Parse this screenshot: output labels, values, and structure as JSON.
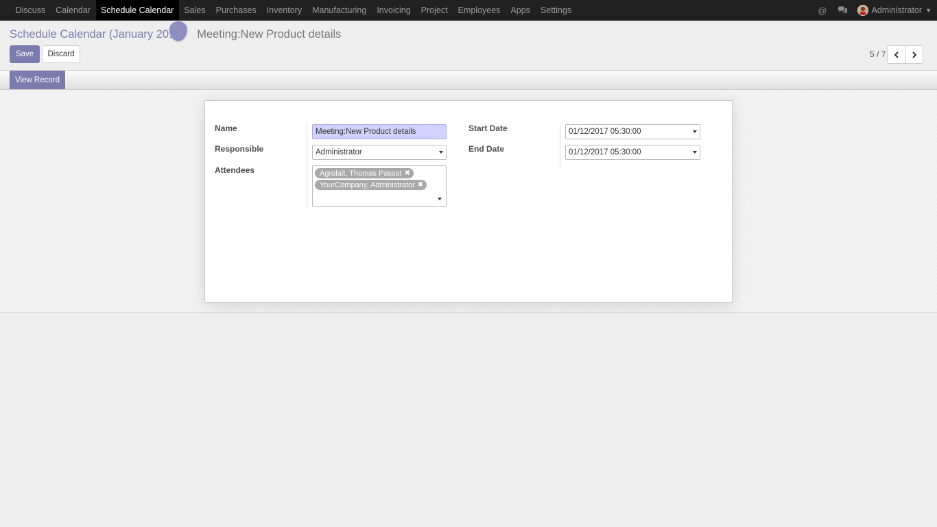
{
  "nav": {
    "items": [
      {
        "label": "Discuss"
      },
      {
        "label": "Calendar"
      },
      {
        "label": "Schedule Calendar"
      },
      {
        "label": "Sales"
      },
      {
        "label": "Purchases"
      },
      {
        "label": "Inventory"
      },
      {
        "label": "Manufacturing"
      },
      {
        "label": "Invoicing"
      },
      {
        "label": "Project"
      },
      {
        "label": "Employees"
      },
      {
        "label": "Apps"
      },
      {
        "label": "Settings"
      }
    ],
    "active": "Schedule Calendar",
    "mention_icon": "@",
    "user": "Administrator"
  },
  "breadcrumb": {
    "parent": "Schedule Calendar (January 201",
    "current": "Meeting:New Product details"
  },
  "buttons": {
    "save": "Save",
    "discard": "Discard",
    "view_record": "View Record"
  },
  "pager": {
    "value": "5 / 7"
  },
  "form": {
    "name_label": "Name",
    "name_value": "Meeting:New Product details",
    "responsible_label": "Responsible",
    "responsible_value": "Administrator",
    "attendees_label": "Attendees",
    "attendees": [
      "Agrolait, Thomas Passot",
      "YourCompany, Administrator"
    ],
    "start_label": "Start Date",
    "start_value": "01/12/2017 05:30:00",
    "end_label": "End Date",
    "end_value": "01/12/2017 05:30:00"
  },
  "colors": {
    "accent": "#7c7bad",
    "navbar": "#212121",
    "focused_input": "#d2d2ff",
    "tag": "#a8a8a8"
  }
}
